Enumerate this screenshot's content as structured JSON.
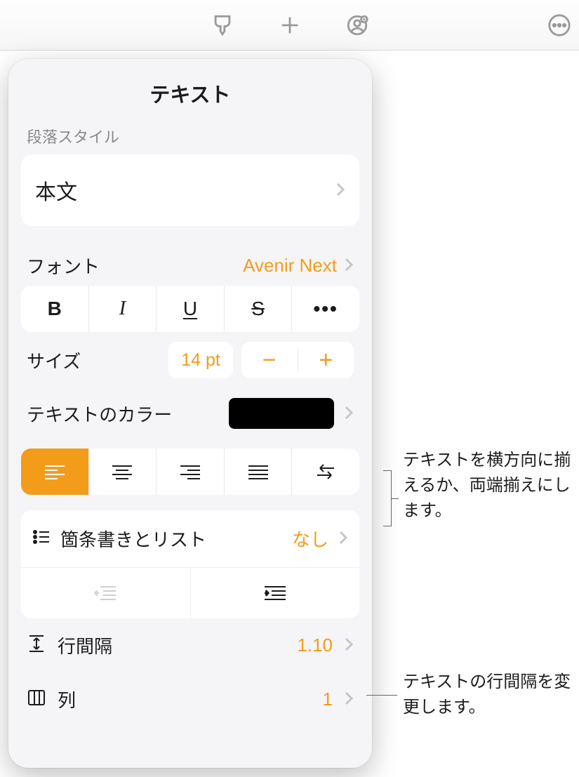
{
  "toolbar": {
    "format_icon": "format-brush-icon",
    "add_icon": "plus-icon",
    "collab_icon": "collaborate-icon",
    "more_icon": "more-icon"
  },
  "popover": {
    "title": "テキスト",
    "paragraph_style": {
      "label": "段落スタイル",
      "value": "本文"
    },
    "font": {
      "label": "フォント",
      "value": "Avenir Next"
    },
    "style_buttons": {
      "bold": "B",
      "italic": "I",
      "underline": "U",
      "strike": "S",
      "more": "•••"
    },
    "size": {
      "label": "サイズ",
      "value": "14 pt",
      "minus": "−",
      "plus": "+"
    },
    "text_color": {
      "label": "テキストのカラー",
      "color": "#000000"
    },
    "alignment": {
      "active": "left",
      "options": [
        "left",
        "center",
        "right",
        "justify",
        "direction"
      ]
    },
    "bullets": {
      "label": "箇条書きとリスト",
      "value": "なし"
    },
    "line_spacing": {
      "label": "行間隔",
      "value": "1.10"
    },
    "columns": {
      "label": "列",
      "value": "1"
    }
  },
  "callouts": {
    "alignment": "テキストを横方向に揃えるか、両端揃えにします。",
    "spacing": "テキストの行間隔を変更します。"
  }
}
